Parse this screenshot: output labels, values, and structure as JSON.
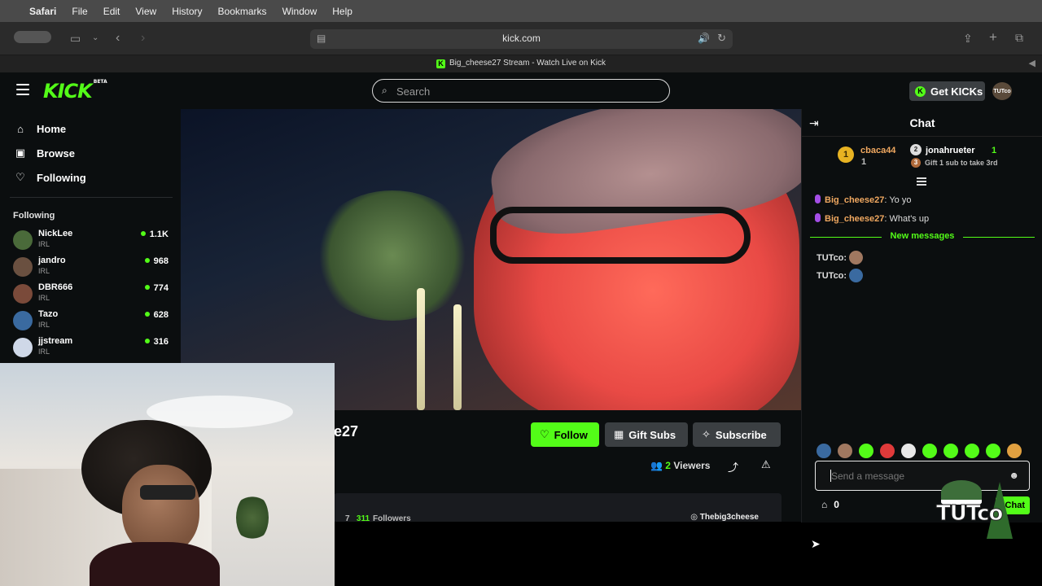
{
  "menubar": {
    "apple": "",
    "app_name": "Safari",
    "items": [
      "File",
      "Edit",
      "View",
      "History",
      "Bookmarks",
      "Window",
      "Help"
    ]
  },
  "browser": {
    "url": "kick.com",
    "tab_title": "Big_cheese27 Stream - Watch Live on Kick"
  },
  "kick_header": {
    "logo_text": "KICK",
    "logo_badge": "BETA",
    "search_placeholder": "Search",
    "get_kicks_label": "Get KICKs",
    "avatar_text": "TUTco"
  },
  "sidebar": {
    "nav": [
      {
        "label": "Home",
        "icon": "home-icon"
      },
      {
        "label": "Browse",
        "icon": "browse-icon"
      },
      {
        "label": "Following",
        "icon": "heart-icon"
      }
    ],
    "following_title": "Following",
    "channels": [
      {
        "name": "NickLee",
        "category": "IRL",
        "viewers": "1.1K",
        "color": "#4a6a3a"
      },
      {
        "name": "jandro",
        "category": "IRL",
        "viewers": "968",
        "color": "#6a5040"
      },
      {
        "name": "DBR666",
        "category": "IRL",
        "viewers": "774",
        "color": "#7a4a3a"
      },
      {
        "name": "Tazo",
        "category": "IRL",
        "viewers": "628",
        "color": "#3a6aa0"
      },
      {
        "name": "jjstream",
        "category": "IRL",
        "viewers": "316",
        "color": "#cfd8e8"
      }
    ]
  },
  "stream": {
    "streamer_name_partial": "e27",
    "follow_label": "Follow",
    "gift_label": "Gift Subs",
    "subscribe_label": "Subscribe",
    "viewer_count": "2",
    "viewers_label": "Viewers",
    "followers_count": "311",
    "followers_label": "Followers",
    "instagram_handle": "Thebig3cheese",
    "followers_prefix": "7"
  },
  "chat": {
    "title": "Chat",
    "leaderboard": [
      {
        "rank": "1",
        "user": "cbaca44",
        "count": "1"
      },
      {
        "rank": "2",
        "user": "jonahrueter",
        "count": "1"
      }
    ],
    "leaderboard_third": "Gift 1 sub to take 3rd",
    "third_rank": "3",
    "messages": [
      {
        "user": "Big_cheese27",
        "text": "Yo yo"
      },
      {
        "user": "Big_cheese27",
        "text": "What's up"
      }
    ],
    "new_messages_label": "New messages",
    "emote_messages": [
      {
        "user": "TUTco:"
      },
      {
        "user": "TUTco:"
      }
    ],
    "input_placeholder": "Send a message",
    "points": "0",
    "send_label": "Chat"
  },
  "overlay": {
    "brand": "TUTco"
  },
  "colors": {
    "accent": "#53fc18",
    "background": "#0b0e0f",
    "button_dark": "#3b3f42"
  }
}
